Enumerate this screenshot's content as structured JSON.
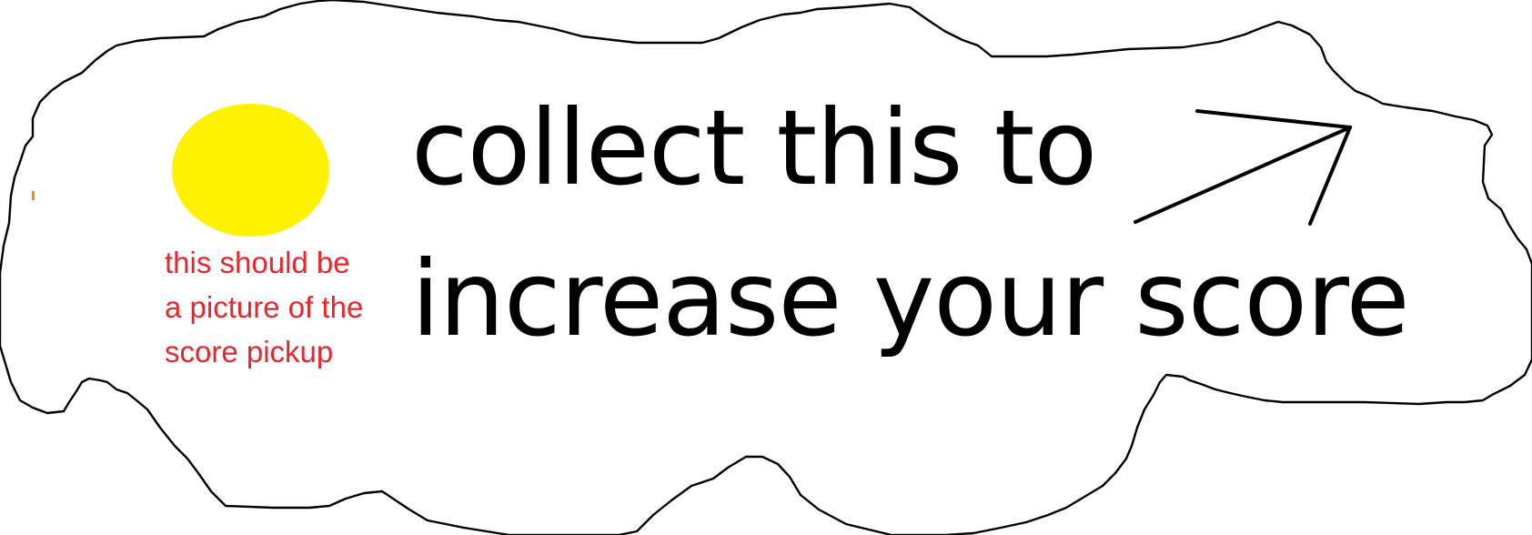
{
  "scene": {
    "colors": {
      "background": "#ffffff",
      "outline": "#000000",
      "coin": "#fff200",
      "note_text": "#e8262b",
      "headline_text": "#000000"
    }
  },
  "pickup": {
    "icon": "score-pickup-icon"
  },
  "note": {
    "lines": [
      "this should be",
      "a picture of the",
      "score pickup"
    ]
  },
  "headline": {
    "line1": "collect this to",
    "line2": "increase your score"
  },
  "arrow": {
    "icon": "arrow-icon"
  }
}
